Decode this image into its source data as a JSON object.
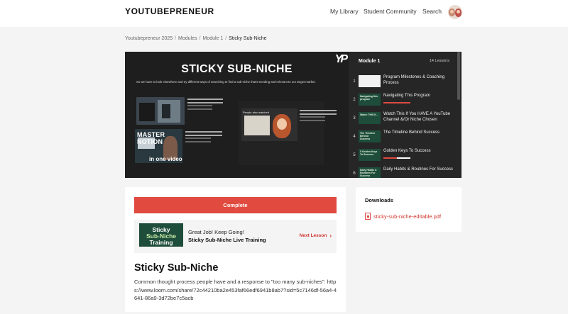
{
  "header": {
    "brand": "YOUTUBEPRENEUR",
    "nav": [
      "My Library",
      "Student Community",
      "Search"
    ],
    "avatar_icon": "couple-avatar"
  },
  "breadcrumb": {
    "items": [
      "Youtubepreneur 2025",
      "Modules",
      "Module 1"
    ],
    "current": "Sticky Sub-Niche",
    "separator": "/"
  },
  "video": {
    "title": "STICKY SUB-NICHE",
    "subtitle": "So we have to look elsewhere and try different ways of searching to find a sub-niche that's trending and relevant to our target market.",
    "logo": "YP",
    "thumb2_heading": "MASTER NOTION",
    "thumb2_overlay": "in one video",
    "thumb3_tag": "People also watched"
  },
  "playlist": {
    "title": "Module 1",
    "count": "14 Lessons",
    "items": [
      {
        "num": "1",
        "label": "Program Milestones & Coaching Process",
        "thumb": "",
        "progress": null
      },
      {
        "num": "2",
        "label": "Navigating This Program",
        "thumb": "Navigating this program",
        "progress": 1.0
      },
      {
        "num": "3",
        "label": "Watch This If You HAVE A YouTube Channel &/Or Niche Chosen",
        "thumb": "Watch THIS If...",
        "progress": null
      },
      {
        "num": "4",
        "label": "The Timeline Behind Success",
        "thumb": "The Timeline Behind Success",
        "progress": null
      },
      {
        "num": "5",
        "label": "Golden Keys To Success",
        "thumb": "5 Golden Keys To Success",
        "progress": 0.5
      },
      {
        "num": "6",
        "label": "Daily Habits & Routines For Success",
        "thumb": "Daily Habits & Routines For Success",
        "progress": null
      }
    ]
  },
  "main": {
    "complete_label": "Complete",
    "next_thumb_lines": [
      "Sticky",
      "Sub-Niche",
      "Training"
    ],
    "next_line1": "Great Job! Keep Going!",
    "next_line2": "Sticky Sub-Niche Live Training",
    "next_link": "Next Lesson",
    "lesson_title": "Sticky Sub-Niche",
    "lesson_desc": "Common thought process people have and a response to \"too many sub-niches\": https://www.loom.com/share/72c44210ba2e453faf66edf6941b8ab7?sid=5c7146df-56a4-4641-86a9-3d72be7c5acb"
  },
  "downloads": {
    "title": "Downloads",
    "file": "sticky-sub-niche-editable.pdf"
  },
  "colors": {
    "accent": "#e04a3f",
    "video_bg": "#1e1e1e",
    "playlist_bg": "#262626",
    "thumb_green": "#1f4d3c"
  }
}
